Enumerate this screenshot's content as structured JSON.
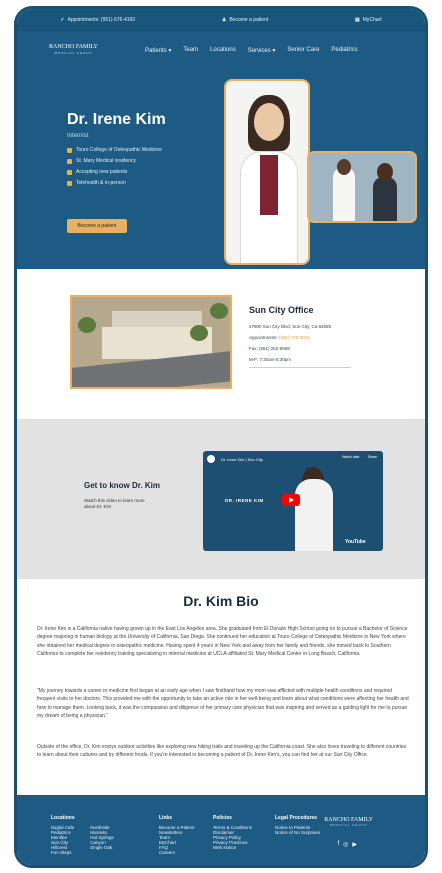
{
  "topbar": {
    "appointments": "Appointments: (951) 676-4160",
    "become": "Become a patient",
    "mychart": "MyChart"
  },
  "logo": {
    "name": "RANCHO FAMILY",
    "tagline": "MEDICAL GROUP"
  },
  "nav": [
    "Patients ▾",
    "Team",
    "Locations",
    "Services ▾",
    "Senior Care",
    "Pediatrics"
  ],
  "hero": {
    "name": "Dr. Irene Kim",
    "title": "Internist",
    "bullets": [
      "Touro College of Osteopathic Medicine",
      "St. Mary Medical residency",
      "Accepting new patients",
      "Telehealth & in-person"
    ],
    "button": "Become a patient"
  },
  "office": {
    "title": "Sun City Office",
    "address": "27800 Sun City Blvd, Sun City, Ca 92585",
    "appointments_label": "Appointments:",
    "appointments_phone": "(951) 723-3834",
    "fax": "Fax: (951) 252-8968",
    "hours": "M-F: 7:30am-5:30pm"
  },
  "video": {
    "heading": "Get to know Dr. Kim",
    "description": "Watch this video to learn more about Dr. Kim",
    "player_title": "Dr. Irene Kim | Sun City",
    "overlay_name": "DR. IRENE KIM",
    "watch_later": "Watch later",
    "share": "Share",
    "brand": "YouTube"
  },
  "bio": {
    "heading": "Dr. Kim Bio",
    "p1": "Dr. Irene Kim is a California native having grown up in the East Los Angeles area. She graduated from El Dorado High School going on to pursue a Bachelor of Science degree majoring in human biology at the University of California, San Diego. She continued her education at Touro College of Osteopathic Medicine in New York where she obtained her medical degree in osteopathic medicine. Having spent 4 years in New York and away from her family and friends, she moved back to Southern California to complete her residency training specializing in internal medicine at UCLA-affiliated St. Mary Medical Center in Long Beach, California.",
    "p2": "\"My journey towards a career in medicine first began at an early age when I saw firsthand how my mom was afflicted with multiple health conditions and required frequent visits to her doctors. This provided me with the opportunity to take an active role in her well-being and learn about what conditions were affecting her health and how to manage them. Looking back, it was the compassion and diligence of her primary care physician that was inspiring and served as a guiding light for me to pursue my dream of being a physician.\"",
    "p3": "Outside of the office, Dr. Kim enjoys outdoor activities like exploring new hiking trails and traveling up the California coast. She also loves traveling to different countries to learn about their cultures and try different foods. If you're interested in becoming a patient of Dr. Irene Kim's, you can find her at our Sun City Office."
  },
  "footer": {
    "locations": {
      "heading": "Locations",
      "col1": [
        "Digital Cafe",
        "Pediatrics",
        "Menifee",
        "Sun City",
        "Hillcrest",
        "Fun Steps"
      ],
      "col2": [
        "Northside",
        "Murrieta",
        "Hot Springs",
        "Canyon",
        "Single Oak"
      ]
    },
    "links": {
      "heading": "Links",
      "items": [
        "Become a Patient",
        "Newsletters",
        "Team",
        "MyChart",
        "FAQ",
        "Careers"
      ]
    },
    "policies": {
      "heading": "Policies",
      "items": [
        "Terms & Conditions",
        "Disclaimer",
        "Privacy Policy",
        "Privacy Practices",
        "Web Notice"
      ]
    },
    "legal": {
      "heading": "Legal Procedures",
      "items": [
        "Notice to Patients",
        "Notice of No Surprises"
      ]
    },
    "logo_name": "RANCHO FAMILY",
    "logo_tagline": "MEDICAL GROUP",
    "social_icons": [
      "facebook-icon",
      "instagram-icon",
      "youtube-icon"
    ]
  },
  "colors": {
    "primary": "#1d5b84",
    "accent": "#e8b063"
  }
}
